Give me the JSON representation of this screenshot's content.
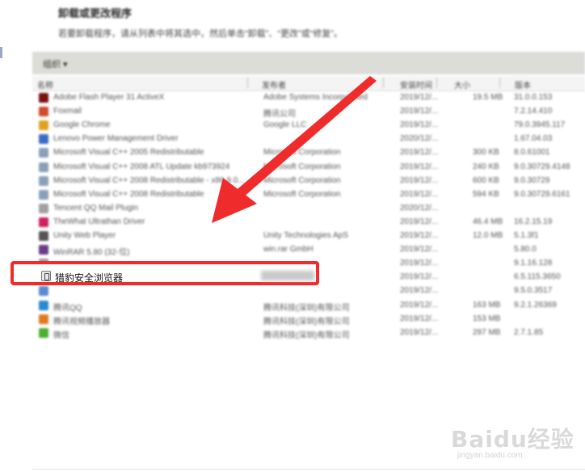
{
  "header": {
    "title": "卸载或更改程序",
    "description": "若要卸载程序，请从列表中将其选中，然后单击“卸载”、“更改”或“修复”。"
  },
  "toolbar": {
    "organize_label": "组织 ▾"
  },
  "columns": [
    {
      "label": "名称"
    },
    {
      "label": "发布者"
    },
    {
      "label": "安装时间"
    },
    {
      "label": "大小"
    },
    {
      "label": "版本"
    }
  ],
  "rows": [
    {
      "name": "Adobe Flash Player 31 ActiveX",
      "publisher": "Adobe Systems Incorporated",
      "date": "2019/12/...",
      "size": "19.5 MB",
      "version": "31.0.0.153",
      "icon_color": "#7a1010"
    },
    {
      "name": "Foxmail",
      "publisher": "腾讯公司",
      "date": "2019/12/...",
      "size": "",
      "version": "7.2.14.410",
      "icon_color": "#d04a2a"
    },
    {
      "name": "Google Chrome",
      "publisher": "Google LLC",
      "date": "2019/12/...",
      "size": "",
      "version": "79.0.3945.117",
      "icon_color": "#e2a11d"
    },
    {
      "name": "Lenovo Power Management Driver",
      "publisher": "",
      "date": "2020/12/...",
      "size": "",
      "version": "1.67.04.03",
      "icon_color": "#3a6ac8"
    },
    {
      "name": "Microsoft Visual C++ 2005 Redistributable",
      "publisher": "Microsoft Corporation",
      "date": "2019/12/...",
      "size": "300 KB",
      "version": "8.0.61001",
      "icon_color": "#8aa0b8"
    },
    {
      "name": "Microsoft Visual C++ 2008 ATL Update kb973924",
      "publisher": "Microsoft Corporation",
      "date": "2019/12/...",
      "size": "240 KB",
      "version": "9.0.30729.4148",
      "icon_color": "#8aa0b8"
    },
    {
      "name": "Microsoft Visual C++ 2008 Redistributable - x86 9.0...",
      "publisher": "Microsoft Corporation",
      "date": "2019/12/...",
      "size": "600 KB",
      "version": "9.0.30729",
      "icon_color": "#8aa0b8"
    },
    {
      "name": "Microsoft Visual C++ 2008 Redistributable",
      "publisher": "Microsoft Corporation",
      "date": "2019/12/...",
      "size": "594 KB",
      "version": "9.0.30729.6161",
      "icon_color": "#8aa0b8"
    },
    {
      "name": "Tencent QQ Mail Plugin",
      "publisher": "",
      "date": "2020/12/...",
      "size": "",
      "version": "",
      "icon_color": "#a0a0a0"
    },
    {
      "name": "TheWhat Ultrathan Driver",
      "publisher": "",
      "date": "2019/12/...",
      "size": "46.4 MB",
      "version": "16.2.15.19",
      "icon_color": "#d02060"
    },
    {
      "name": "Unity Web Player",
      "publisher": "Unity Technologies ApS",
      "date": "2019/12/...",
      "size": "12.0 MB",
      "version": "5.1.3f1",
      "icon_color": "#555555"
    },
    {
      "name": "WinRAR 5.80 (32-位)",
      "publisher": "win.rar GmbH",
      "date": "2019/12/...",
      "size": "",
      "version": "5.80.0",
      "icon_color": "#6a3a8a"
    },
    {
      "name": "",
      "publisher": "",
      "date": "2019/12/...",
      "size": "",
      "version": "9.1.16.128",
      "icon_color": "#9a9a9a"
    },
    {
      "name": "",
      "publisher": "",
      "date": "2019/12/...",
      "size": "",
      "version": "6.5.115.3650",
      "icon_color": "#9a9a9a"
    },
    {
      "name": "",
      "publisher": "",
      "date": "2019/12/...",
      "size": "",
      "version": "9.5.0.3517",
      "icon_color": "#5a8ad0"
    },
    {
      "name": "腾讯QQ",
      "publisher": "腾讯科技(深圳)有限公司",
      "date": "2019/12/...",
      "size": "163 MB",
      "version": "9.2.1.26369",
      "icon_color": "#2a8ad0"
    },
    {
      "name": "腾讯视频播放器",
      "publisher": "腾讯科技(深圳)有限公司",
      "date": "2019/12/...",
      "size": "153 MB",
      "version": "",
      "icon_color": "#e07a20"
    },
    {
      "name": "微信",
      "publisher": "腾讯科技(深圳)有限公司",
      "date": "2019/12/...",
      "size": "297 MB",
      "version": "2.7.1.85",
      "icon_color": "#4ab030"
    }
  ],
  "highlighted": {
    "name": "猎豹安全浏览器"
  },
  "colors": {
    "highlight": "#ef2b2b",
    "arrow": "#ef2b2b"
  },
  "watermark": {
    "logo": "Baidu经验",
    "url": "jingyan.baidu.com"
  }
}
